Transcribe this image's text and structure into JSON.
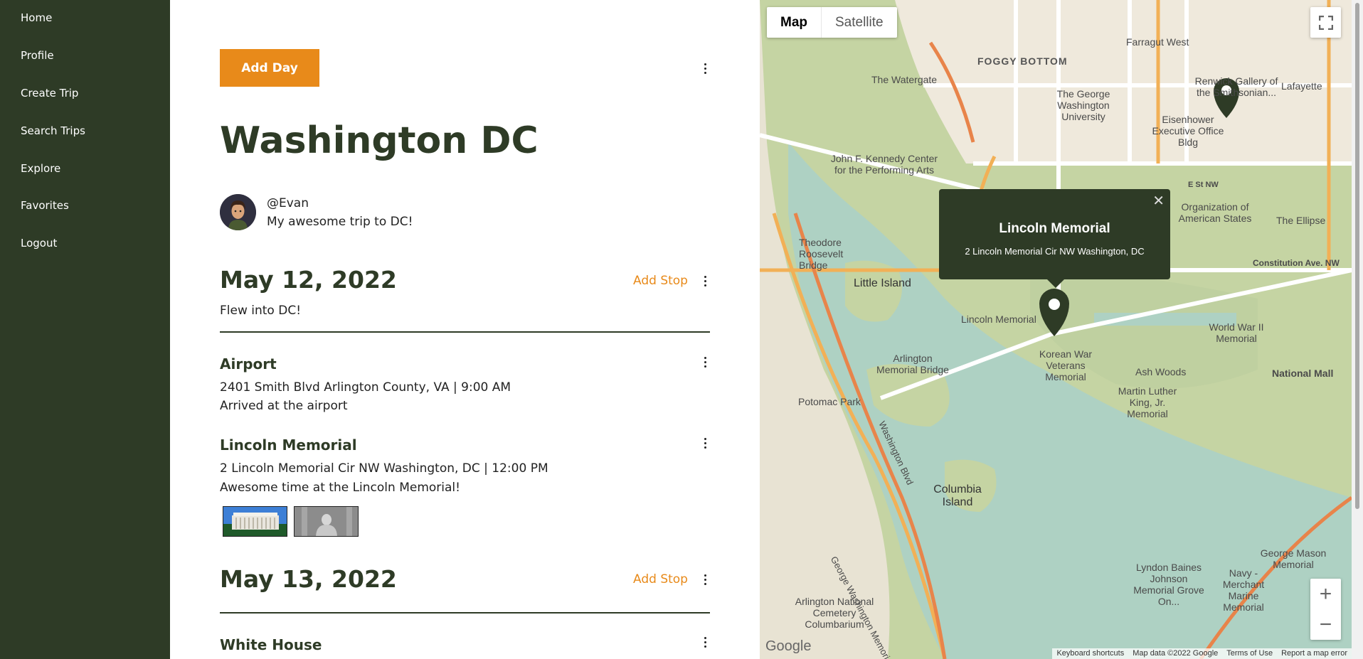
{
  "nav": {
    "items": [
      {
        "label": "Home"
      },
      {
        "label": "Profile"
      },
      {
        "label": "Create Trip"
      },
      {
        "label": "Search Trips"
      },
      {
        "label": "Explore"
      },
      {
        "label": "Favorites"
      },
      {
        "label": "Logout"
      }
    ]
  },
  "trip": {
    "add_day_label": "Add Day",
    "title": "Washington DC",
    "username": "@Evan",
    "description": "My awesome trip to DC!"
  },
  "days": [
    {
      "date": "May 12, 2022",
      "add_stop_label": "Add Stop",
      "note": "Flew into DC!",
      "stops": [
        {
          "name": "Airport",
          "details": "2401 Smith Blvd Arlington County, VA | 9:00 AM",
          "note": "Arrived at the airport"
        },
        {
          "name": "Lincoln Memorial",
          "details": "2 Lincoln Memorial Cir NW Washington, DC | 12:00 PM",
          "note": "Awesome time at the Lincoln Memorial!"
        }
      ]
    },
    {
      "date": "May 13, 2022",
      "add_stop_label": "Add Stop",
      "stops": [
        {
          "name": "White House"
        }
      ]
    }
  ],
  "map": {
    "type_tabs": [
      "Map",
      "Satellite"
    ],
    "zoom_in": "+",
    "zoom_out": "−",
    "popup": {
      "title": "Lincoln Memorial",
      "address": "2 Lincoln Memorial Cir NW Washington, DC"
    },
    "labels": {
      "foggy_bottom": "FOGGY BOTTOM",
      "little_island": "Little Island",
      "lincoln_memorial": "Lincoln Memorial",
      "columbia_island": "Columbia Island",
      "national_mall": "National Mall",
      "ellipse": "The Ellipse",
      "watergate": "The Watergate",
      "kennedy_center": "John F. Kennedy Center for the Performing Arts",
      "potomac_park": "Potomac Park",
      "arlington_bridge": "Arlington Memorial Bridge",
      "korean_war": "Korean War Veterans Memorial",
      "mlk": "Martin Luther King, Jr. Memorial",
      "ash_woods": "Ash Woods",
      "wwii": "World War II Memorial",
      "gwu": "The George Washington University",
      "eisenhower": "Eisenhower Executive Office Bldg",
      "constitution": "Constitution Ave. NW",
      "e_st": "E St NW",
      "lyndon": "Lyndon Baines Johnson Memorial Grove On...",
      "navy": "Navy - Merchant Marine Memorial",
      "george_mason": "George Mason Memorial",
      "arlington_nat": "Arlington National Cemetery Columbarium",
      "farragut": "Farragut West",
      "lafayette": "Lafayette",
      "roosevelt": "Theodore Roosevelt Bridge",
      "gw_pkwy": "George Washington Memorial Pkwy",
      "washington_blvd": "Washington Blvd",
      "renwick": "Renwick Gallery of the Smithsonian...",
      "oas": "Organization of American States"
    },
    "attribution": [
      "Keyboard shortcuts",
      "Map data ©2022 Google",
      "Terms of Use",
      "Report a map error"
    ],
    "google": "Google"
  },
  "colors": {
    "sidebar": "#2e3b26",
    "accent": "#e88a1a",
    "title": "#2e3b26"
  }
}
